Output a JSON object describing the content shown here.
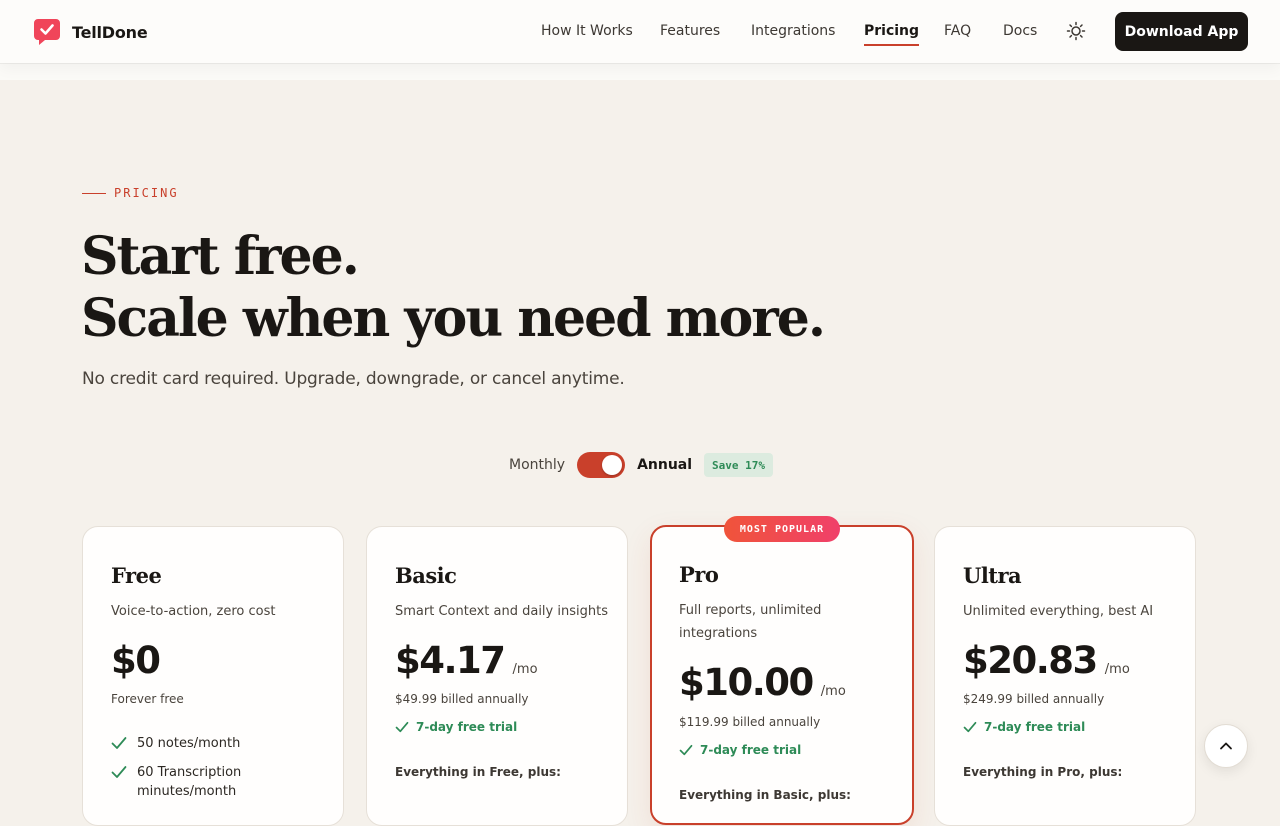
{
  "header": {
    "brand": {
      "name": "TellDone",
      "logo_icon": "checkmark-speech-bubble-icon",
      "logo_color": "#f0455a"
    },
    "nav": [
      {
        "label": "How It Works",
        "active": false
      },
      {
        "label": "Features",
        "active": false
      },
      {
        "label": "Integrations",
        "active": false
      },
      {
        "label": "Pricing",
        "active": true
      },
      {
        "label": "FAQ",
        "active": false
      },
      {
        "label": "Docs",
        "active": false
      }
    ],
    "theme_toggle_icon": "sun-icon",
    "download_label": "Download App"
  },
  "hero": {
    "eyebrow": "PRICING",
    "headline_line1": "Start free.",
    "headline_line2": "Scale when you need more.",
    "subhead": "No credit card required. Upgrade, downgrade, or cancel anytime."
  },
  "billing": {
    "monthly_label": "Monthly",
    "annual_label": "Annual",
    "selected": "Annual",
    "save_badge": "Save 17%"
  },
  "plans": [
    {
      "name": "Free",
      "tagline": "Voice-to-action, zero cost",
      "price": "$0",
      "billed": "Forever free",
      "features": [
        "50 notes/month",
        "60 Transcription minutes/month"
      ]
    },
    {
      "name": "Basic",
      "tagline": "Smart Context and daily insights",
      "price": "$4.17",
      "per": "/mo",
      "billed": "$49.99 billed annually",
      "trial": "7-day free trial",
      "everything": "Everything in Free, plus:"
    },
    {
      "name": "Pro",
      "badge": "MOST POPULAR",
      "tagline": "Full reports, unlimited integrations",
      "price": "$10.00",
      "per": "/mo",
      "billed": "$119.99 billed annually",
      "trial": "7-day free trial",
      "everything": "Everything in Basic, plus:"
    },
    {
      "name": "Ultra",
      "tagline": "Unlimited everything, best AI",
      "price": "$20.83",
      "per": "/mo",
      "billed": "$249.99 billed annually",
      "trial": "7-day free trial",
      "everything": "Everything in Pro, plus:"
    }
  ],
  "scroll_top_icon": "chevron-up-icon",
  "colors": {
    "accent": "#c9402b",
    "background": "#f5f1eb",
    "success": "#2e8b57",
    "dark": "#1a1714"
  }
}
